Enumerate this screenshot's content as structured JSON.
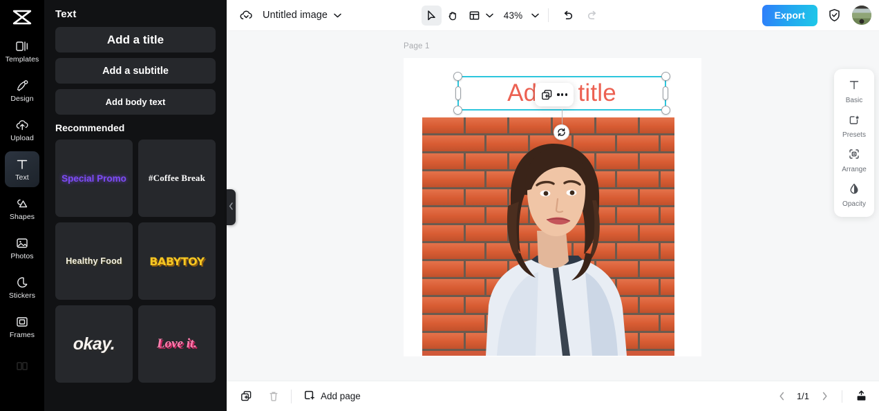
{
  "app": {
    "logo": "capcut-logo"
  },
  "rail": {
    "items": [
      {
        "label": "Templates",
        "icon": "templates-icon",
        "active": false
      },
      {
        "label": "Design",
        "icon": "design-icon",
        "active": false
      },
      {
        "label": "Upload",
        "icon": "upload-cloud-icon",
        "active": false
      },
      {
        "label": "Text",
        "icon": "text-icon",
        "active": true
      },
      {
        "label": "Shapes",
        "icon": "shapes-icon",
        "active": false
      },
      {
        "label": "Photos",
        "icon": "photos-icon",
        "active": false
      },
      {
        "label": "Stickers",
        "icon": "stickers-icon",
        "active": false
      },
      {
        "label": "Frames",
        "icon": "frames-icon",
        "active": false
      }
    ]
  },
  "panel": {
    "title": "Text",
    "add_buttons": [
      {
        "label": "Add a title"
      },
      {
        "label": "Add a subtitle"
      },
      {
        "label": "Add body text"
      }
    ],
    "recommended_title": "Recommended",
    "recommended": [
      {
        "label": "Special Promo",
        "style": "pv-special"
      },
      {
        "label": "#Coffee Break",
        "style": "pv-coffee"
      },
      {
        "label": "Healthy Food",
        "style": "pv-healthy"
      },
      {
        "label": "BABYTOY",
        "style": "pv-baby"
      },
      {
        "label": "okay.",
        "style": "pv-okay"
      },
      {
        "label": "Love it.",
        "style": "pv-love"
      }
    ],
    "collapse_icon": "chevron-left-icon"
  },
  "topbar": {
    "cloud_icon": "cloud-save-icon",
    "doc_title": "Untitled image",
    "title_chevron": "chevron-down-icon",
    "tools": [
      {
        "name": "select-tool",
        "icon": "cursor-arrow-icon",
        "active": true
      },
      {
        "name": "hand-tool",
        "icon": "hand-icon",
        "active": false
      },
      {
        "name": "layout-tool",
        "icon": "layout-grid-icon",
        "active": false
      }
    ],
    "layout_chevron": "chevron-down-icon",
    "zoom_level": "43%",
    "zoom_chevron": "chevron-down-icon",
    "undo_icon": "undo-icon",
    "redo_icon": "redo-icon",
    "export_label": "Export",
    "shield_icon": "shield-check-icon",
    "avatar": "user-avatar"
  },
  "canvas": {
    "page_label": "Page 1",
    "selected_text": "Add a title",
    "selected_text_color": "#ec6152",
    "selection_color": "#2cc6dd",
    "rotate_icon": "rotate-icon",
    "context_menu": {
      "duplicate_icon": "duplicate-icon",
      "more_icon": "more-options-icon"
    },
    "photo_alt": "young-woman-white-puffer-jacket-brick-wall"
  },
  "right_panel": {
    "items": [
      {
        "label": "Basic",
        "icon": "text-basic-icon"
      },
      {
        "label": "Presets",
        "icon": "presets-icon"
      },
      {
        "label": "Arrange",
        "icon": "arrange-icon"
      },
      {
        "label": "Opacity",
        "icon": "opacity-icon"
      }
    ]
  },
  "bottombar": {
    "duplicate_page_icon": "duplicate-page-icon",
    "delete_page_icon": "trash-icon",
    "add_page_label": "Add page",
    "add_page_icon": "add-page-icon",
    "prev_icon": "chevron-left-icon",
    "page_indicator": "1/1",
    "next_icon": "chevron-right-icon",
    "export_page_icon": "export-upload-icon"
  },
  "colors": {
    "accent_export_start": "#2f7dfb",
    "accent_export_end": "#1ec8e8",
    "selection": "#2cc6dd",
    "title_text": "#ec6152",
    "rail_bg": "#000000",
    "panel_bg": "#111214"
  }
}
